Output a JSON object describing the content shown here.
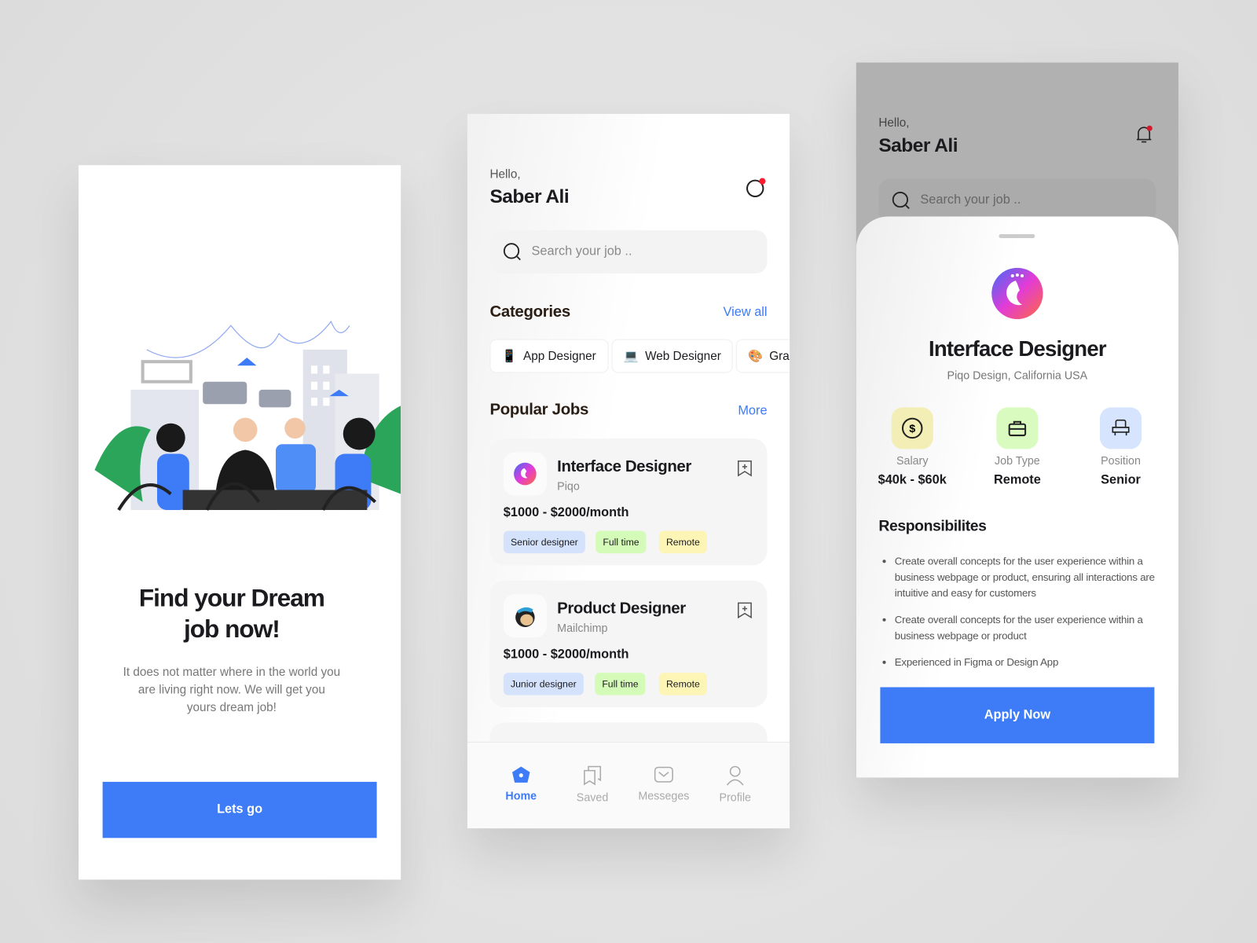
{
  "onboarding": {
    "title_line1": "Find your Dream",
    "title_line2": "job now!",
    "body": "It does not matter where in the world you are living right now. We will get you yours dream job!",
    "cta": "Lets go"
  },
  "home": {
    "greeting": "Hello,",
    "user": "Saber Ali",
    "search_placeholder": "Search your job ..",
    "categories_title": "Categories",
    "view_all": "View all",
    "categories": [
      {
        "label": "App Designer",
        "icon": "mobile-phone-icon"
      },
      {
        "label": "Web Designer",
        "icon": "laptop-icon"
      },
      {
        "label": "Grap",
        "icon": "palette-icon"
      }
    ],
    "popular_title": "Popular Jobs",
    "more": "More",
    "jobs": [
      {
        "title": "Interface Designer",
        "company": "Piqo",
        "pay": "$1000 - $2000/month",
        "tags": [
          "Senior designer",
          "Full time",
          "Remote"
        ]
      },
      {
        "title": "Product Designer",
        "company": "Mailchimp",
        "pay": "$1000 - $2000/month",
        "tags": [
          "Junior designer",
          "Full time",
          "Remote"
        ]
      }
    ],
    "nav": [
      {
        "label": "Home",
        "active": true
      },
      {
        "label": "Saved"
      },
      {
        "label": "Messeges"
      },
      {
        "label": "Profile"
      }
    ],
    "colors": {
      "accent": "#3d7bf7",
      "tag_blue": "#d4e2fb",
      "tag_green": "#d5fbb8",
      "tag_yellow": "#fdf5b5"
    }
  },
  "detail": {
    "greeting": "Hello,",
    "user": "Saber Ali",
    "search_placeholder": "Search your job ..",
    "title": "Interface Designer",
    "company": "Piqo Design, California USA",
    "stats": [
      {
        "label": "Salary",
        "value": "$40k - $60k"
      },
      {
        "label": "Job Type",
        "value": "Remote"
      },
      {
        "label": "Position",
        "value": "Senior"
      }
    ],
    "resp_title": "Responsibilites",
    "responsibilities": [
      "Create overall concepts for the user experience within a business webpage or product, ensuring all interactions are intuitive and easy for customers",
      "Create overall concepts for the user experience within a business webpage or product",
      "Experienced in Figma or Design App"
    ],
    "apply": "Apply Now"
  }
}
